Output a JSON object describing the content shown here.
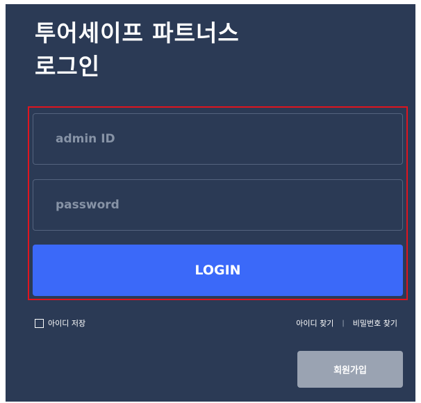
{
  "header": {
    "title_line1": "투어세이프 파트너스",
    "title_line2": "로그인"
  },
  "form": {
    "id_placeholder": "admin ID",
    "id_value": "",
    "password_placeholder": "password",
    "password_value": "",
    "login_label": "LOGIN",
    "remember_label": "아이디 저장",
    "remember_checked": false
  },
  "links": {
    "find_id": "아이디 찾기",
    "separator": "|",
    "find_password": "비밀번호 찾기"
  },
  "signup": {
    "label": "회원가입"
  },
  "colors": {
    "background": "#2b3a55",
    "accent": "#3b69f9",
    "highlight_border": "#e0141e",
    "secondary_button": "#9aa3b2"
  }
}
